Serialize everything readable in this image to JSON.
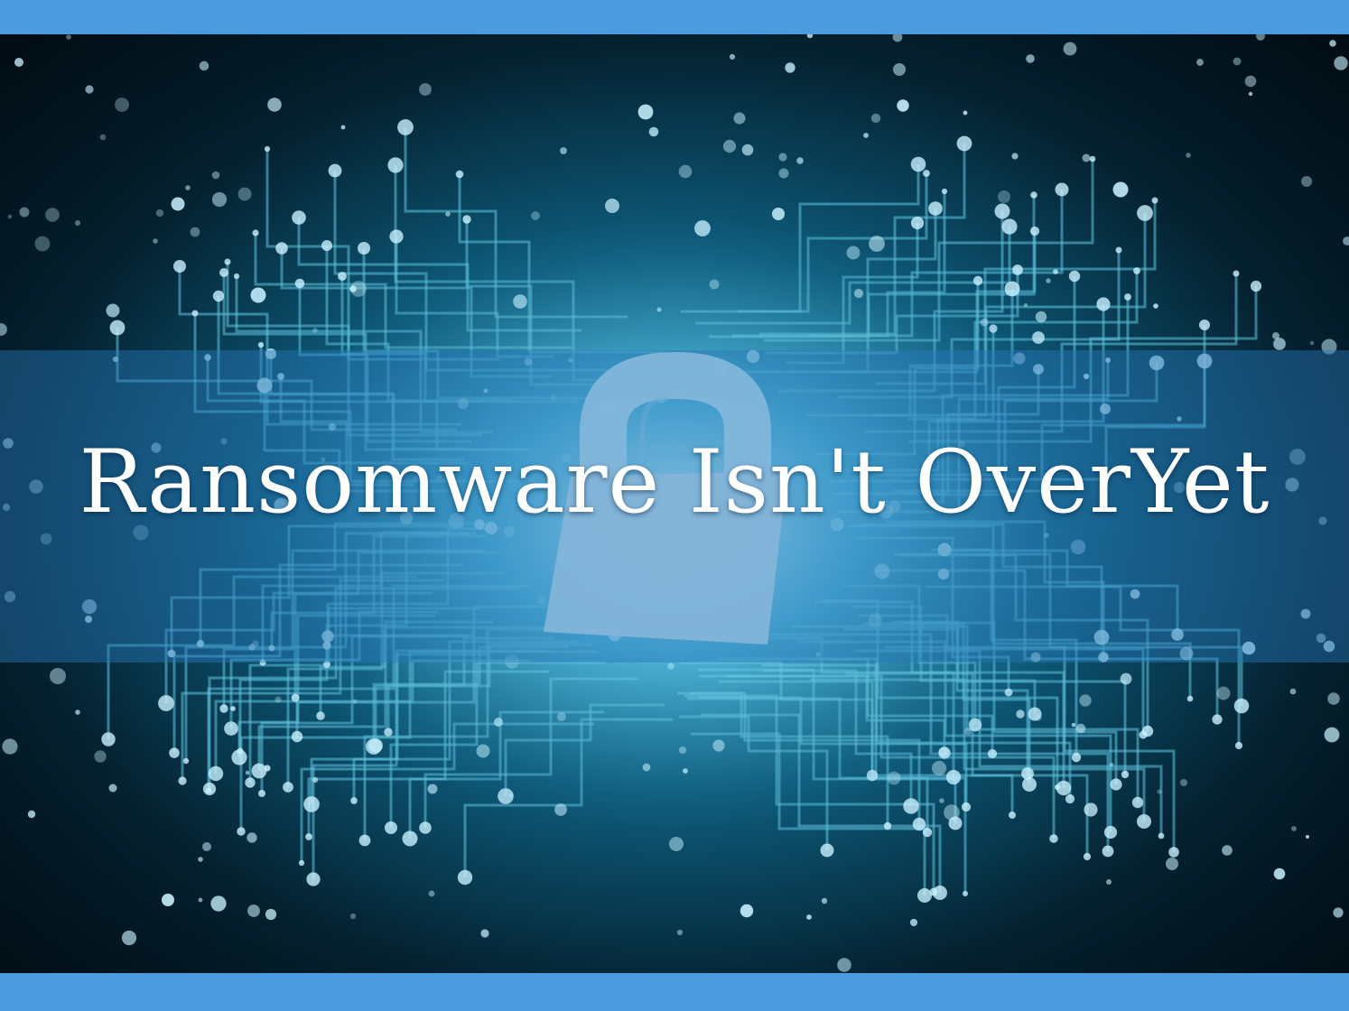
{
  "colors": {
    "frame": "#4a9be0",
    "band": "#2878b9",
    "title_text": "#ffffff",
    "circuit_glow": "#7fd6f2"
  },
  "image": {
    "subject": "circuit-board-with-padlock",
    "icon": "padlock-icon"
  },
  "headline": {
    "text": "Ransomware Isn't OverYet"
  }
}
